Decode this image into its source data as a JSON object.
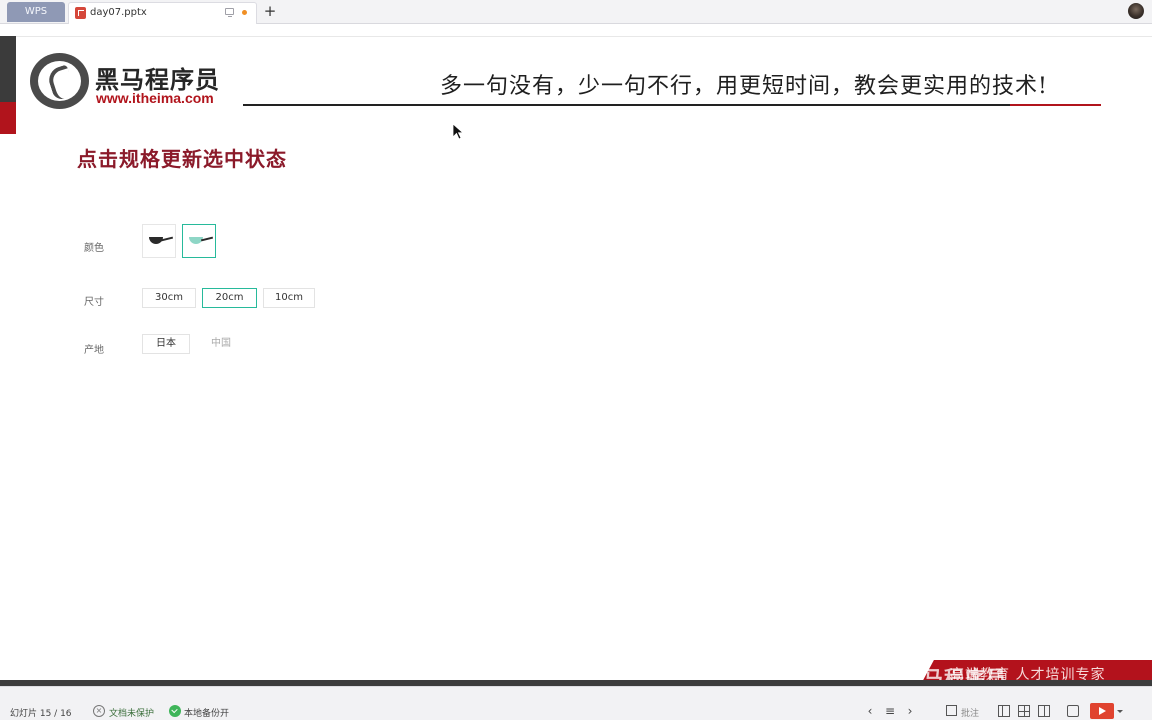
{
  "app": {
    "name": "WPS"
  },
  "tabs": [
    {
      "title": "day07.pptx"
    }
  ],
  "slide": {
    "brand_cn": "黑马程序员",
    "brand_url": "www.itheima.com",
    "slogan": "多一句没有，少一句不行，用更短时间，教会更实用的技术!",
    "title": "点击规格更新选中状态",
    "specs": {
      "color": {
        "label": "颜色",
        "options": [
          {
            "name": "black-pan",
            "selected": false
          },
          {
            "name": "mint-pan",
            "selected": true
          }
        ]
      },
      "size": {
        "label": "尺寸",
        "options": [
          {
            "label": "30cm",
            "selected": false
          },
          {
            "label": "20cm",
            "selected": true
          },
          {
            "label": "10cm",
            "selected": false
          }
        ]
      },
      "origin": {
        "label": "产地",
        "options": [
          {
            "label": "日本",
            "selected": false
          },
          {
            "label": "中国",
            "disabled": true
          }
        ]
      }
    }
  },
  "watermark": {
    "text": "高端教育 人才培训专家",
    "brand": "黑马程序员"
  },
  "status_bar": {
    "slide_counter": "幻灯片 15 / 16",
    "protect_label": "文档未保护",
    "backup_label": "本地备份开",
    "comment_label": "批注"
  },
  "colors": {
    "accent": "#27ba9b",
    "brand_red": "#b1141c",
    "title_red": "#8b1a2a",
    "wps_tab": "#8f99b5"
  }
}
